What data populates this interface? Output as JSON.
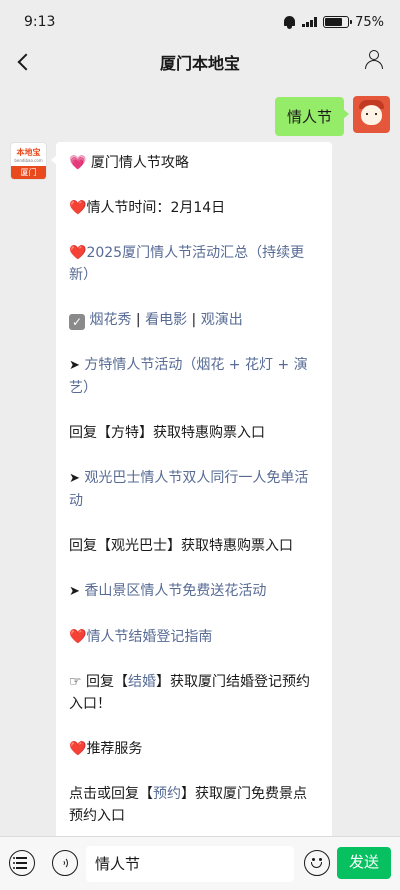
{
  "status_bar": {
    "time": "9:13",
    "battery_text": "75",
    "battery_level": 0.75
  },
  "nav": {
    "title": "厦门本地宝"
  },
  "outgoing": {
    "text": "情人节"
  },
  "bot_avatar": {
    "logo_text": "本地宝",
    "domain_text": "bendibao.com",
    "city_text": "厦门"
  },
  "incoming": {
    "heading": "厦门情人节攻略",
    "time_prefix": "情人节时间：",
    "time_value": "2月14日",
    "summary_link": "2025厦门情人节活动汇总（持续更新）",
    "quick_links": [
      "烟花秀",
      "看电影",
      "观演出"
    ],
    "separator": " | ",
    "fangte_link": "方特情人节活动（烟花 + 花灯 + 演艺）",
    "fangte_reply": "回复【方特】获取特惠购票入口",
    "bus_link": "观光巴士情人节双人同行一人免单活动",
    "bus_reply": "回复【观光巴士】获取特惠购票入口",
    "xiangshan_link": "香山景区情人节免费送花活动",
    "marriage_link": "情人节结婚登记指南",
    "marriage_reply_prefix": "回复【",
    "marriage_reply_link": "结婚",
    "marriage_reply_suffix": "】获取厦门结婚登记预约入口！",
    "services_heading": "推荐服务",
    "booking_prefix": "点击或回复【",
    "booking_link": "预约",
    "booking_suffix": "】获取厦门免费景点预约入口"
  },
  "input_bar": {
    "text_value": "情人节",
    "send_label": "发送"
  },
  "icons": {
    "heart_pink": "💗",
    "heart_red": "❤️",
    "check": "✓",
    "arrow": "➤",
    "pointing_hand": "☞"
  },
  "colors": {
    "link": "#576b95",
    "send_button": "#07c160",
    "outgoing_bubble": "#95ec69",
    "bot_brand": "#e8491d"
  }
}
